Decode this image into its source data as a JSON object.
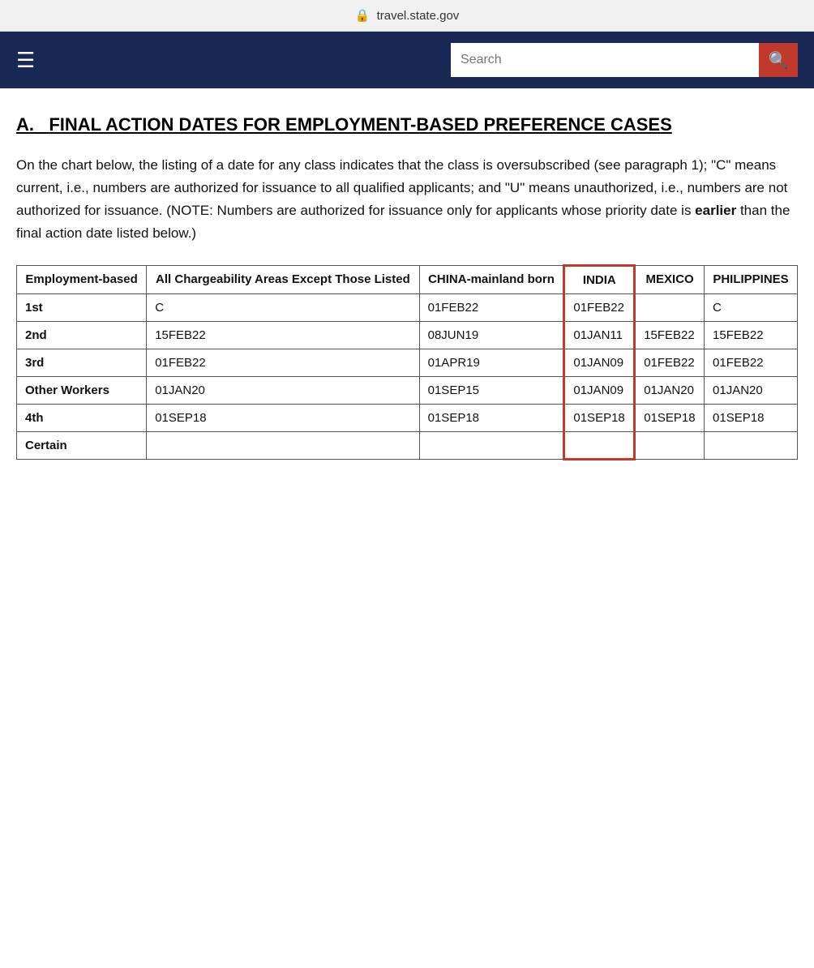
{
  "addressBar": {
    "lock": "🔒",
    "url": "travel.state.gov"
  },
  "navbar": {
    "hamburger": "☰",
    "search": {
      "placeholder": "Search",
      "buttonIcon": "🔍"
    }
  },
  "section": {
    "labelA": "A.",
    "title": "FINAL ACTION DATES FOR EMPLOYMENT-BASED PREFERENCE CASES",
    "description": "On the chart below, the listing of a date for any class indicates that the class is oversubscribed (see paragraph 1); \"C\" means current, i.e., numbers are authorized for issuance to all qualified applicants; and \"U\" means unauthorized, i.e., numbers are not authorized for issuance. (NOTE: Numbers are authorized for issuance only for applicants whose priority date is ",
    "descriptionBold": "earlier",
    "descriptionEnd": " than the final action date listed below.)"
  },
  "table": {
    "headers": [
      "Employment-based",
      "All Chargeability Areas Except Those Listed",
      "CHINA-mainland born",
      "INDIA",
      "MEXICO",
      "PHILIPPINES"
    ],
    "rows": [
      {
        "category": "1st",
        "allChargeability": "C",
        "china": "01FEB22",
        "india": "01FEB22",
        "mexico": "",
        "philippines": "C"
      },
      {
        "category": "2nd",
        "allChargeability": "15FEB22",
        "china": "08JUN19",
        "india": "01JAN11",
        "mexico": "15FEB22",
        "philippines": "15FEB22"
      },
      {
        "category": "3rd",
        "allChargeability": "01FEB22",
        "china": "01APR19",
        "india": "01JAN09",
        "mexico": "01FEB22",
        "philippines": "01FEB22"
      },
      {
        "category": "Other Workers",
        "allChargeability": "01JAN20",
        "china": "01SEP15",
        "india": "01JAN09",
        "mexico": "01JAN20",
        "philippines": "01JAN20"
      },
      {
        "category": "4th",
        "allChargeability": "01SEP18",
        "china": "01SEP18",
        "india": "01SEP18",
        "mexico": "01SEP18",
        "philippines": "01SEP18"
      },
      {
        "category": "Certain",
        "allChargeability": "",
        "china": "",
        "india": "",
        "mexico": "",
        "philippines": ""
      }
    ]
  }
}
